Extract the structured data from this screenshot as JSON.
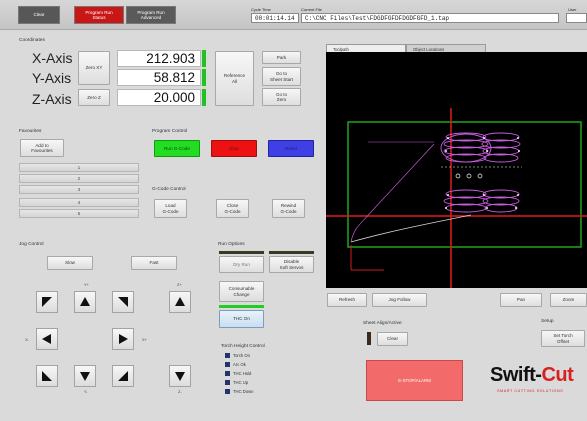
{
  "topbar": {
    "btn_clear": "Clear",
    "btn_program_run": "Program Run\nStatus",
    "btn_program_run_advanced": "Program Run\nAdvanced",
    "cycle_time_label": "Cycle Time",
    "cycle_time": "00:01:14.14",
    "current_file_label": "Current File",
    "current_file": "C:\\CNC Files\\Test\\FDGDFGFDFDGDFGFD_1.tap",
    "user_label": "User"
  },
  "coordinates": {
    "title": "Coordinates",
    "x_label": "X-Axis",
    "x_value": "212.903",
    "y_label": "Y-Axis",
    "y_value": "58.812",
    "z_label": "Z-Axis",
    "z_value": "20.000",
    "zero_xy": "Zero XY",
    "zero_z": "Zero Z",
    "reference_all": "Reference\nAll",
    "park": "Park",
    "goto_sheet_start": "Go to\nSheet Start",
    "goto_zero": "Go to\nZero"
  },
  "favourites": {
    "title": "Favourites",
    "add": "Add to\nFavourites",
    "items": [
      "1",
      "2",
      "3",
      "4",
      "5"
    ]
  },
  "program_control": {
    "title": "Program Control",
    "run": "Run G-Code",
    "stop": "Stop",
    "reset": "Reset"
  },
  "gcode_control": {
    "title": "G-Code Control",
    "load": "Load\nG-Code",
    "close": "Close\nG-Code",
    "rewind": "Rewind\nG-Code"
  },
  "jog_control": {
    "title": "Jog Control",
    "slow": "Slow",
    "fast": "Fast",
    "y_plus": "Y+",
    "y_minus": "Y-",
    "x_minus": "X-",
    "x_plus": "X+",
    "z_plus": "Z+",
    "z_minus": "Z-"
  },
  "run_options": {
    "title": "Run Options",
    "dry_run": "Dry Run",
    "disable_soft_servos": "Disable\nSoft Servos",
    "consumable_change": "Consumable\nChange",
    "thc_on": "THC On"
  },
  "torch_height_control": {
    "title": "Torch Height Control",
    "items": [
      "Torch On",
      "Arc Ok",
      "THC Hold",
      "THC Up",
      "THC Down"
    ]
  },
  "viewer": {
    "tab_toolpath": "Toolpath",
    "tab_other": "Object Locations",
    "refresh": "Refresh",
    "jog_follow": "Jog Follow",
    "pan": "Pan",
    "zoom": "Zoom"
  },
  "sheet_align": {
    "title": "Sheet Align/Active",
    "clear": "Clear"
  },
  "setup": {
    "title": "Setup",
    "set_torch_offset": "Set Torch\nOffset"
  },
  "alarm": {
    "label": "E-STOP/ALARM",
    "color": "#f26a6a"
  },
  "brand": {
    "name_a": "Swift-",
    "name_b": "Cut",
    "tagline": "SMART CUTTING SOLUTIONS"
  },
  "colors": {
    "run": "#22dd22",
    "stop": "#ee1111",
    "reset": "#3f3fe6",
    "topbar_red": "#c91616",
    "topbar_dark": "#5a5a5a"
  }
}
